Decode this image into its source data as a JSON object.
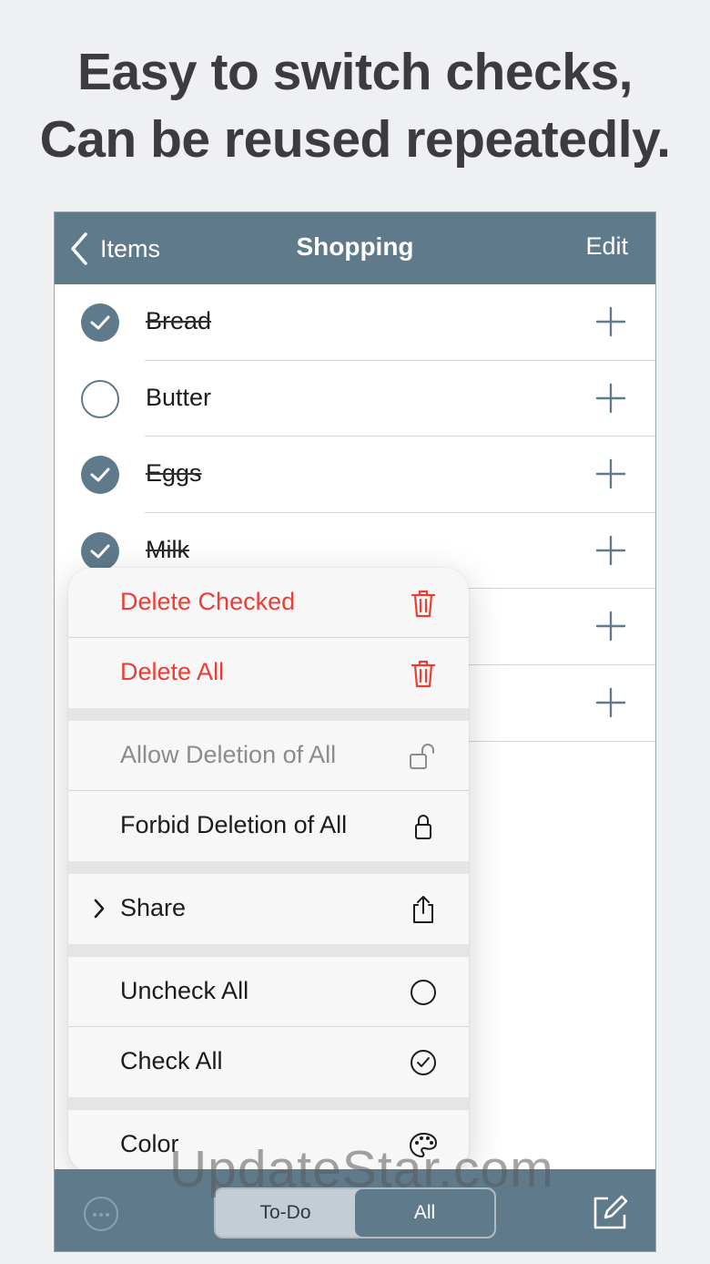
{
  "headline": {
    "line1": "Easy to switch checks,",
    "line2": "Can be reused repeatedly."
  },
  "navbar": {
    "back_label": "Items",
    "title": "Shopping",
    "edit_label": "Edit",
    "color": "#5f7a8b"
  },
  "items": [
    {
      "label": "Bread",
      "checked": true
    },
    {
      "label": "Butter",
      "checked": false
    },
    {
      "label": "Eggs",
      "checked": true
    },
    {
      "label": "Milk",
      "checked": true
    },
    {
      "label": "",
      "checked": null
    },
    {
      "label": "",
      "checked": null
    }
  ],
  "menu": {
    "delete_checked": "Delete Checked",
    "delete_all": "Delete All",
    "allow_deletion": "Allow Deletion of All",
    "forbid_deletion": "Forbid Deletion of All",
    "share": "Share",
    "uncheck_all": "Uncheck All",
    "check_all": "Check All",
    "color": "Color"
  },
  "toolbar": {
    "segment_todo": "To-Do",
    "segment_all": "All",
    "selected_segment": "All"
  },
  "watermark": "UpdateStar.com",
  "colors": {
    "accent": "#5f7a8b",
    "destructive": "#ea3e35",
    "disabled": "#8c8c90"
  }
}
